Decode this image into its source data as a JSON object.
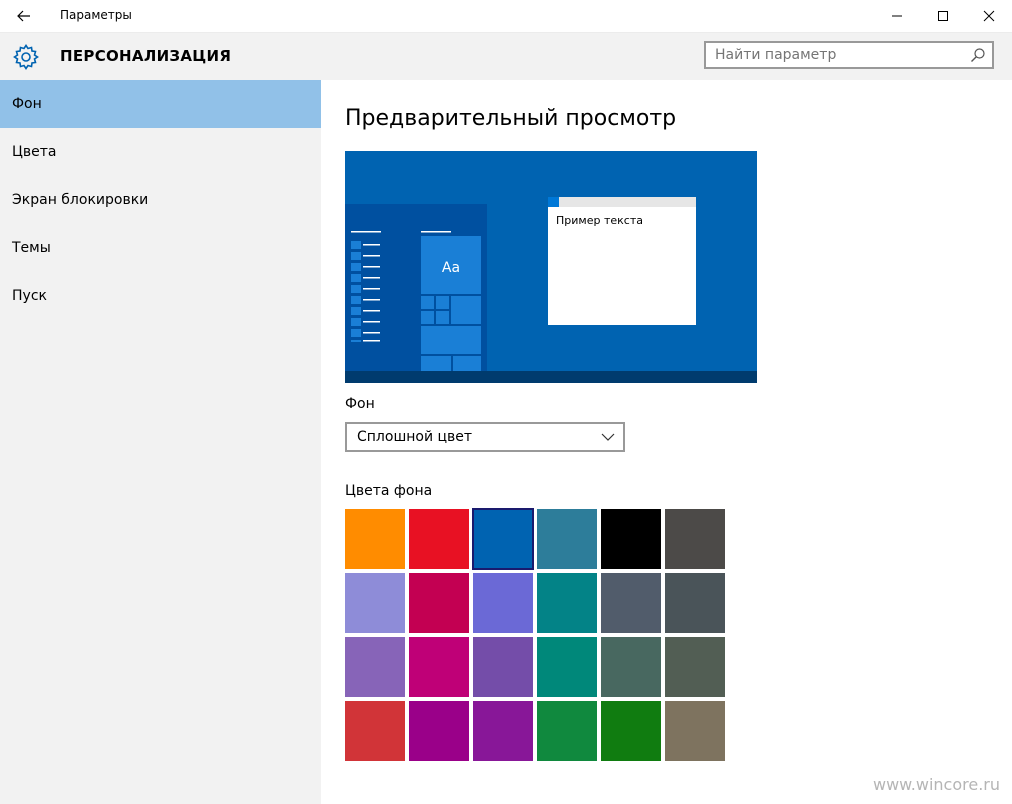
{
  "window": {
    "title": "Параметры"
  },
  "header": {
    "section_title": "ПЕРСОНАЛИЗАЦИЯ",
    "search_placeholder": "Найти параметр"
  },
  "sidebar": {
    "items": [
      {
        "label": "Фон",
        "active": true
      },
      {
        "label": "Цвета",
        "active": false
      },
      {
        "label": "Экран блокировки",
        "active": false
      },
      {
        "label": "Темы",
        "active": false
      },
      {
        "label": "Пуск",
        "active": false
      }
    ]
  },
  "main": {
    "title": "Предварительный просмотр",
    "preview": {
      "tile_text": "Aa",
      "sample_text": "Пример текста",
      "background_color": "#0063b1"
    },
    "background_label": "Фон",
    "background_dropdown_value": "Сплошной цвет",
    "colors_label": "Цвета фона",
    "colors": [
      "#ff8c00",
      "#e81123",
      "#0063b1",
      "#2d7d9a",
      "#000000",
      "#4c4a48",
      "#8e8cd8",
      "#c30052",
      "#6b69d6",
      "#038387",
      "#515c6b",
      "#4a5459",
      "#8764b8",
      "#bf0077",
      "#744da9",
      "#00887a",
      "#486860",
      "#525e54",
      "#d13438",
      "#9a0089",
      "#881798",
      "#10893e",
      "#107c10",
      "#7e735f"
    ],
    "selected_color_index": 2
  },
  "watermark": "www.wincore.ru"
}
